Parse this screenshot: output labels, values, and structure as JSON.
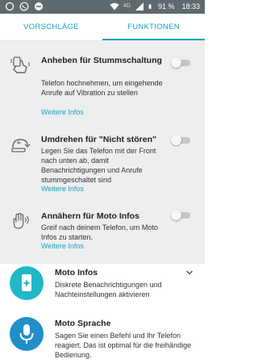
{
  "status_bar": {
    "left_icons": [
      "notification-icon",
      "whatsapp-icon",
      "block-icon"
    ],
    "network": "4G",
    "battery": "91 %",
    "time": "18:33"
  },
  "tabs": [
    {
      "label": "VORSCHLÄGE",
      "active": false
    },
    {
      "label": "FUNKTIONEN",
      "active": true
    }
  ],
  "features": [
    {
      "title": "Anheben für Stummschaltung",
      "description": "Telefon hochnehmen, um eingehende Anrufe auf Vibration zu stellen",
      "link": "Weitere Infos",
      "enabled": false,
      "icon": "lift-phone-icon"
    },
    {
      "title": "Umdrehen für \"Nicht stören\"",
      "description": "Legen Sie das Telefon mit der Front nach unten ab, damit Benachrichtigungen und Anrufe stummgeschaltet sind",
      "link": "Weitere Infos",
      "enabled": false,
      "icon": "flip-phone-icon"
    },
    {
      "title": "Annähern für Moto Infos",
      "description": "Greif nach deinem Telefon, um Moto Infos zu starten.",
      "link": "Weitere Infos",
      "enabled": false,
      "icon": "approach-hand-icon"
    }
  ],
  "apps": [
    {
      "title": "Moto Infos",
      "description": "Diskrete Benachrichtigungen und Nachteinstellungen aktivieren",
      "icon": "moto-display-icon",
      "color": "#21b8c7",
      "expandable": true
    },
    {
      "title": "Moto Sprache",
      "description": "Sagen Sie einen Befehl und Ihr Telefon reagiert. Das ist optimal für die freihändige Bedienung.",
      "icon": "microphone-icon",
      "color": "#1f8ec9",
      "expandable": false
    }
  ]
}
